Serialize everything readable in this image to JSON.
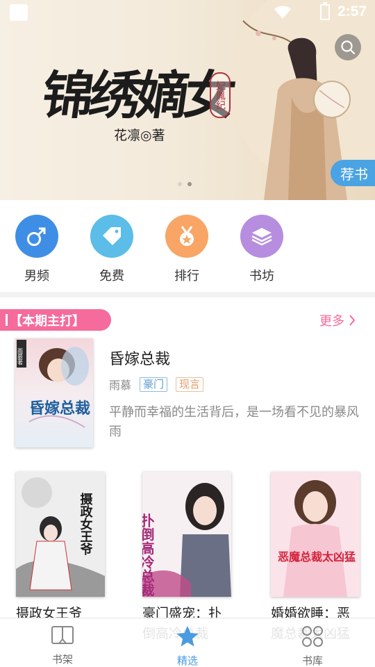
{
  "status_bar": {
    "time": "2:57"
  },
  "banner": {
    "title": "锦绣嫡女",
    "seal": "妃胤纪",
    "author": "花凛◎著",
    "tag": "荐书",
    "page_count": 2,
    "active_page": 2
  },
  "categories": [
    {
      "label": "男频",
      "icon": "male-icon",
      "color": "#3f8ee6"
    },
    {
      "label": "免费",
      "icon": "price-tag-icon",
      "color": "#5bbde8"
    },
    {
      "label": "排行",
      "icon": "medal-icon",
      "color": "#f8a566"
    },
    {
      "label": "书坊",
      "icon": "layers-icon",
      "color": "#b78de0"
    }
  ],
  "section": {
    "title": "【本期主打】",
    "more": "更多"
  },
  "featured": {
    "title": "昏嫁总裁",
    "author": "雨慕",
    "tags": [
      "豪门",
      "现言"
    ],
    "description": "平静而幸福的生活背后，是一场看不见的暴风雨",
    "cover_text": "昏嫁总裁",
    "cover_side": "雨慕著"
  },
  "books": [
    {
      "title": "摄政女王爷",
      "cover_text": "摄政女王爷"
    },
    {
      "title": "豪门盛宠：扑倒高冷总裁",
      "cover_text": "扑倒高冷总裁"
    },
    {
      "title": "婚婚欲睡：恶魔总裁太凶猛",
      "cover_text": "恶魔总裁太凶猛"
    }
  ],
  "nav": [
    {
      "label": "书架",
      "icon": "bookshelf-icon"
    },
    {
      "label": "精选",
      "icon": "star-icon",
      "active": true
    },
    {
      "label": "书库",
      "icon": "grid-icon"
    }
  ],
  "colors": {
    "accent": "#4a9be0",
    "pink": "#f56b9b"
  }
}
